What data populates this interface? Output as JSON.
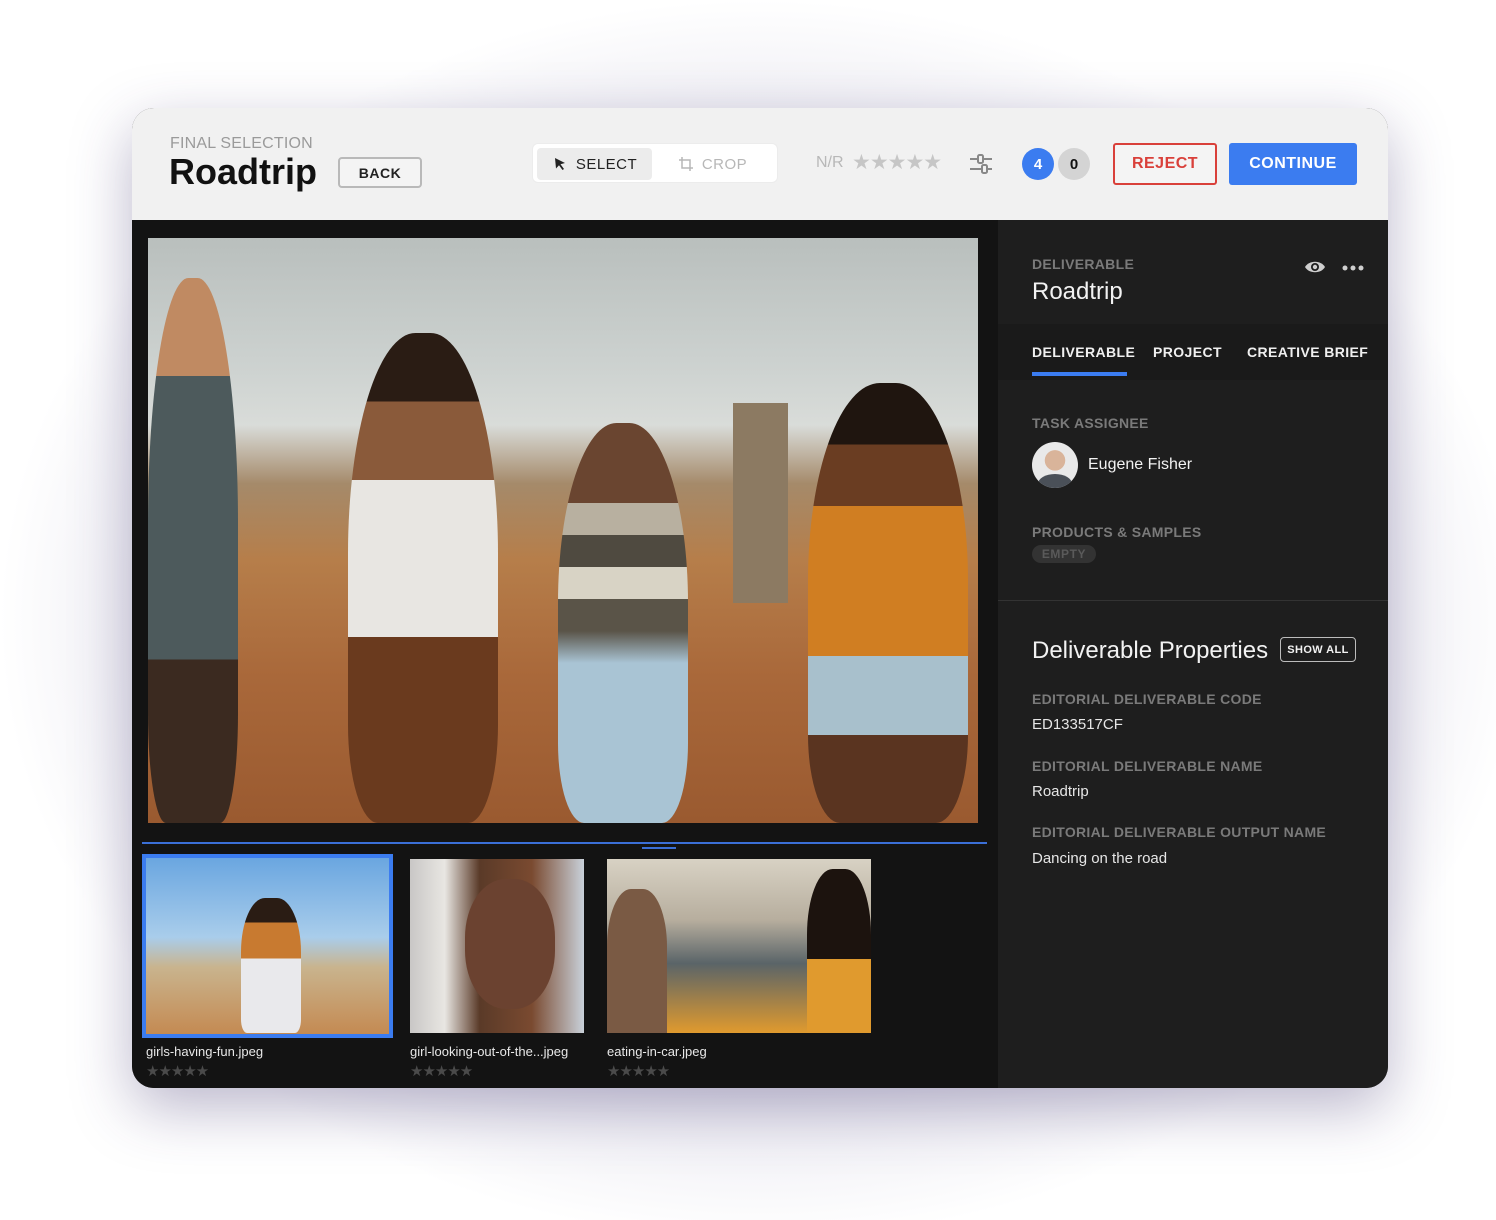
{
  "header": {
    "eyebrow": "FINAL SELECTION",
    "title": "Roadtrip",
    "back_label": "BACK",
    "tools": [
      {
        "label": "SELECT",
        "icon": "cursor-arrow-icon",
        "active": true
      },
      {
        "label": "CROP",
        "icon": "crop-icon",
        "active": false
      }
    ],
    "rating_label": "N/R",
    "rating_stars": "★★★★★",
    "rating_value": 0,
    "accepted_count": "4",
    "rejected_count": "0",
    "reject_label": "REJECT",
    "continue_label": "CONTINUE",
    "colors": {
      "accent": "#3b7cf0",
      "reject": "#d9403a"
    }
  },
  "viewer": {
    "main_image_alt": "Group of friends dancing on a dirt road",
    "thumbnails": [
      {
        "name": "girls-having-fun.jpeg",
        "stars": "★★★★★",
        "rating": 0,
        "selected": true
      },
      {
        "name": "girl-looking-out-of-the...jpeg",
        "stars": "★★★★★",
        "rating": 0,
        "selected": false
      },
      {
        "name": "eating-in-car.jpeg",
        "stars": "★★★★★",
        "rating": 0,
        "selected": false
      }
    ]
  },
  "panel": {
    "eyebrow": "DELIVERABLE",
    "title": "Roadtrip",
    "tabs": [
      {
        "label": "DELIVERABLE",
        "active": true
      },
      {
        "label": "PROJECT",
        "active": false
      },
      {
        "label": "CREATIVE BRIEF",
        "active": false
      }
    ],
    "task_assignee_label": "TASK ASSIGNEE",
    "assignee_name": "Eugene Fisher",
    "products_label": "PRODUCTS & SAMPLES",
    "products_value": "EMPTY",
    "properties_title": "Deliverable Properties",
    "show_all_label": "SHOW ALL",
    "properties": [
      {
        "label": "EDITORIAL DELIVERABLE CODE",
        "value": "ED133517CF"
      },
      {
        "label": "EDITORIAL DELIVERABLE NAME",
        "value": "Roadtrip"
      },
      {
        "label": "EDITORIAL DELIVERABLE OUTPUT NAME",
        "value": "Dancing on the road"
      }
    ]
  }
}
